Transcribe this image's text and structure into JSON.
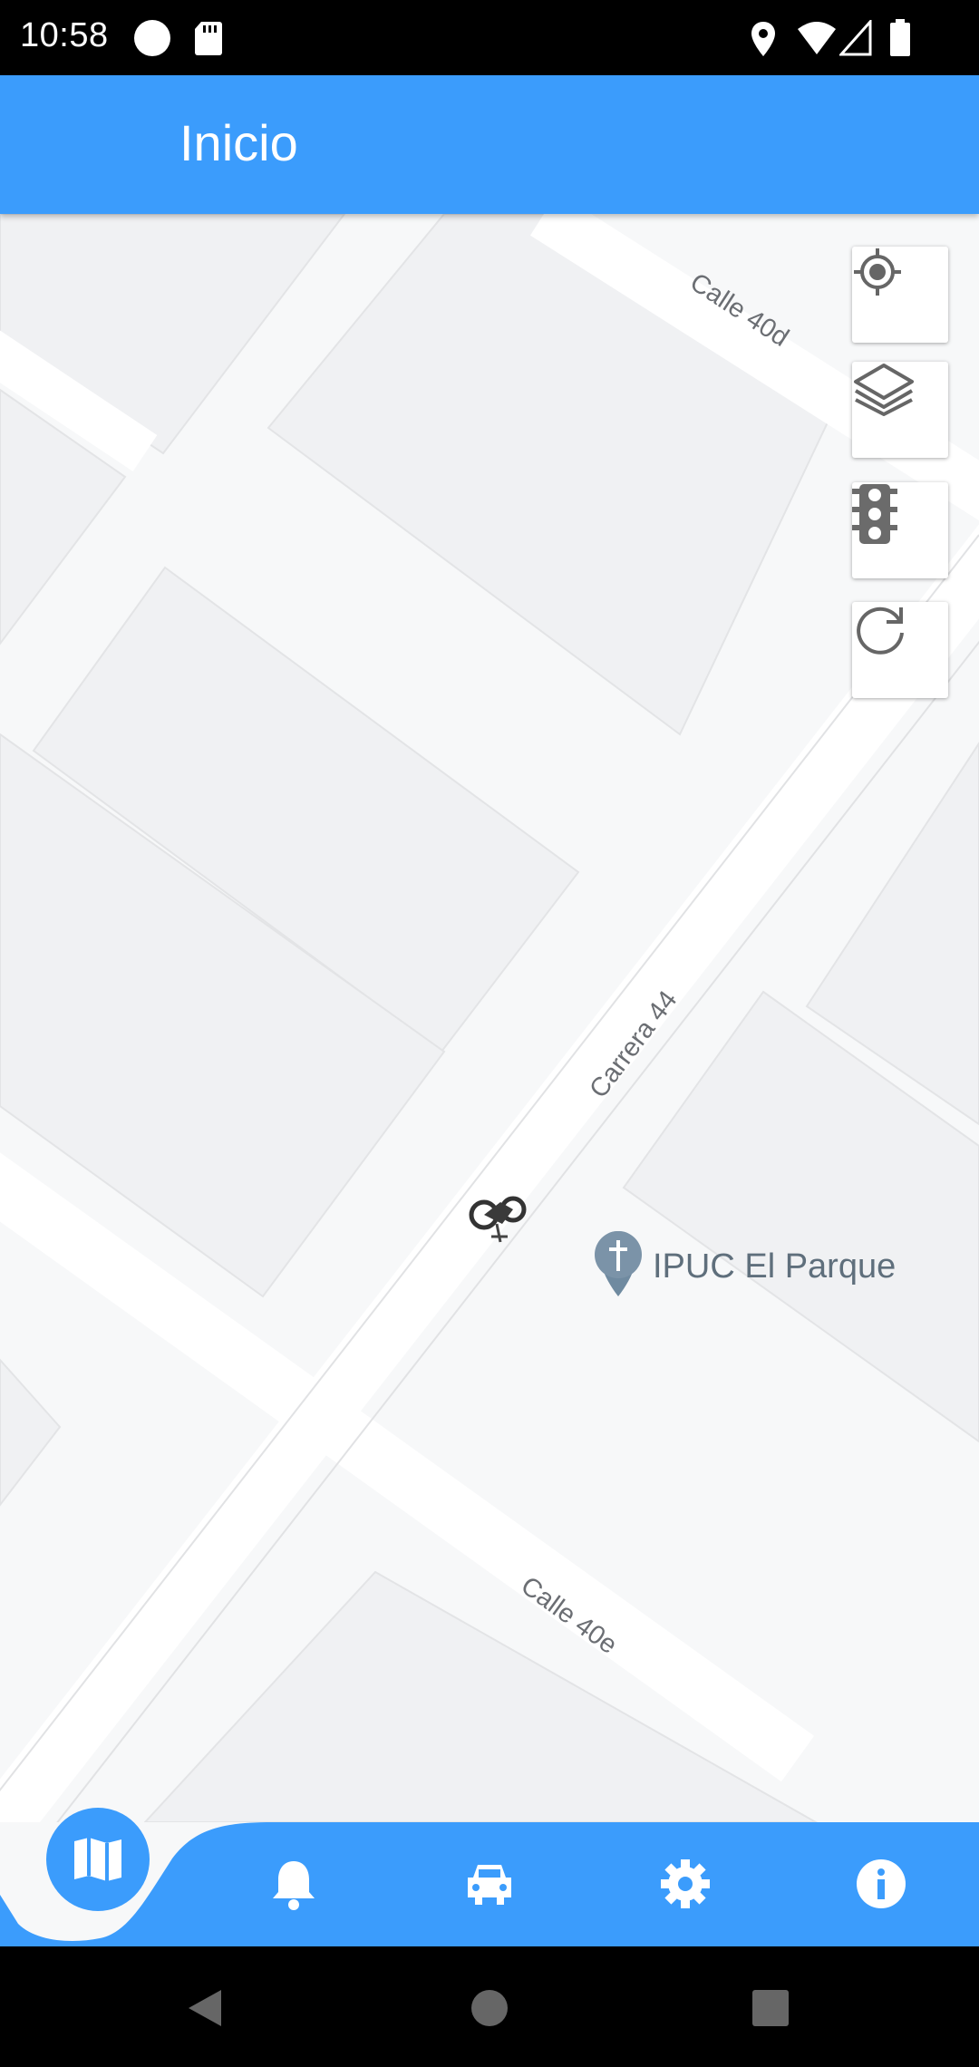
{
  "status_bar": {
    "time": "10:58",
    "icons": [
      "circle-dot-icon",
      "sd-card-icon",
      "location-pin-icon",
      "wifi-icon",
      "signal-icon",
      "battery-icon"
    ]
  },
  "app_bar": {
    "title": "Inicio"
  },
  "map": {
    "streets": {
      "calle_40d": "Calle 40d",
      "carrera_44": "Carrera 44",
      "calle_40e": "Calle 40e"
    },
    "poi": {
      "name": "IPUC El Parque",
      "icon": "church-pin-icon"
    },
    "vehicle_marker": "motorcycle-icon",
    "controls": [
      "my-location-icon",
      "layers-icon",
      "traffic-light-icon",
      "refresh-icon"
    ]
  },
  "bottom_nav": {
    "items": [
      "map-icon",
      "bell-icon",
      "car-icon",
      "gear-icon",
      "info-icon"
    ],
    "active": "map-icon"
  },
  "system_nav": [
    "back-icon",
    "home-icon",
    "recents-icon"
  ],
  "colors": {
    "primary": "#3b9cfc",
    "map_bg": "#f7f8f9",
    "block": "#f0f1f3",
    "road": "#ffffff"
  }
}
